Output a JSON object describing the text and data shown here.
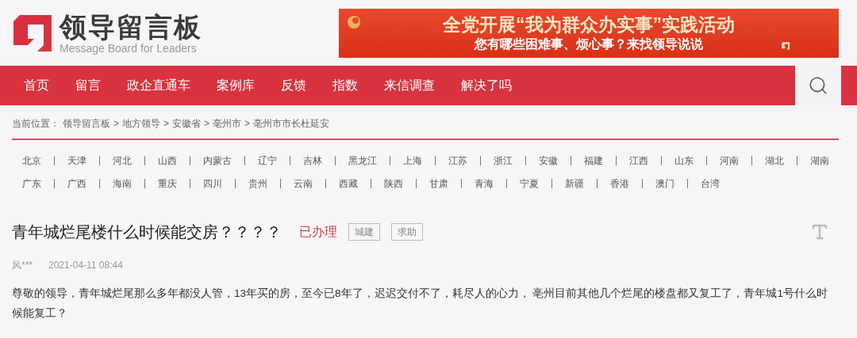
{
  "header": {
    "logo_title": "领导留言板",
    "logo_subtitle": "Message Board for Leaders",
    "banner": {
      "title": "全党开展“我为群众办实事”实践活动",
      "subtitle": "您有哪些困难事、烦心事？来找领导说说"
    }
  },
  "nav": {
    "items": [
      "首页",
      "留言",
      "政企直通车",
      "案例库",
      "反馈",
      "指数",
      "来信调查",
      "解决了吗"
    ]
  },
  "breadcrumb": {
    "label": "当前位置：",
    "separator": ">",
    "items": [
      "领导留言板",
      "地方领导",
      "安徽省",
      "亳州市",
      "亳州市市长杜延安"
    ]
  },
  "provinces": [
    [
      "北京",
      "天津",
      "河北",
      "山西",
      "内蒙古",
      "辽宁",
      "吉林",
      "黑龙江",
      "上海",
      "江苏",
      "浙江",
      "安徽",
      "福建",
      "江西",
      "山东",
      "河南",
      "湖北",
      "湖南"
    ],
    [
      "广东",
      "广西",
      "海南",
      "重庆",
      "四川",
      "贵州",
      "云南",
      "西藏",
      "陕西",
      "甘肃",
      "青海",
      "宁夏",
      "新疆",
      "香港",
      "澳门",
      "台湾"
    ]
  ],
  "message": {
    "title": "青年城烂尾楼什么时候能交房？？？？",
    "status": "已办理",
    "tags": [
      "城建",
      "求助"
    ],
    "author": "风***",
    "time": "2021-04-11 08:44",
    "body": "尊敬的领导，青年城烂尾那么多年都没人管，13年买的房，至今已8年了，迟迟交付不了，耗尽人的心力， 亳州目前其他几个烂尾的楼盘都又复工了，青年城1号什么时候能复工？"
  }
}
